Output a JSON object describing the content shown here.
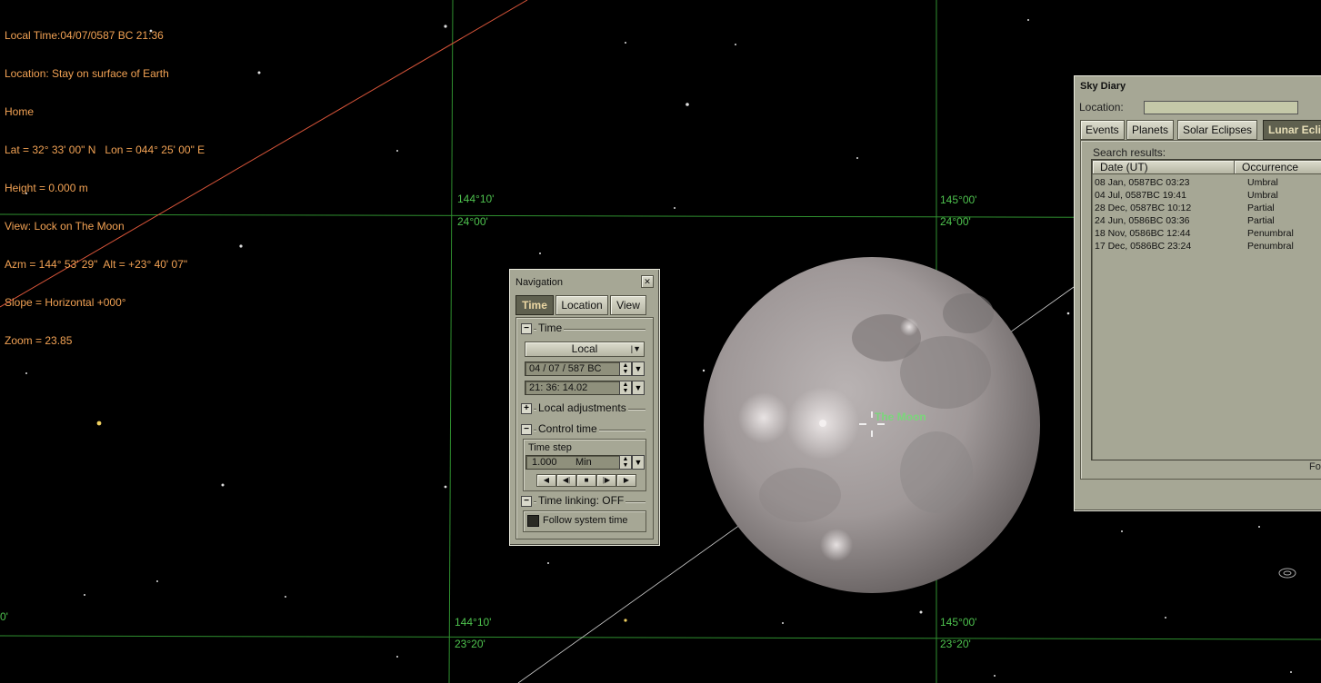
{
  "hud": {
    "lines": [
      "Local Time:04/07/0587 BC 21:36",
      "Location: Stay on surface of Earth",
      "Home",
      "Lat = 32° 33' 00\" N   Lon = 044° 25' 00\" E",
      "Height = 0.000 m",
      "View: Lock on The Moon",
      "Azm = 144° 53' 29\"  Alt = +23° 40' 07\"",
      "Slope = Horizontal +000°",
      "Zoom = 23.85"
    ]
  },
  "grid_labels": {
    "az_left_top": "144°10'",
    "alt_left_top": "24°00'",
    "az_right_top": "145°00'",
    "alt_right_top": "24°00'",
    "az_left_bottom": "144°10'",
    "alt_left_bottom": "23°20'",
    "az_right_bottom": "145°00'",
    "alt_right_bottom": "23°20'",
    "left_edge": "0'"
  },
  "moon": {
    "label": "The Moon"
  },
  "navigation": {
    "title": "Navigation",
    "close_glyph": "✕",
    "tabs": [
      "Time",
      "Location",
      "View"
    ],
    "active_tab": "Time",
    "time_section": "Time",
    "time_mode": "Local",
    "date_value": "04 / 07 /  587    BC",
    "time_value": "21:   36: 14.02",
    "local_adjustments": "Local adjustments",
    "control_time": "Control time",
    "time_step_label": "Time step",
    "time_step_value": "1.000",
    "time_step_unit": "Min",
    "time_linking": "Time linking: OFF",
    "follow_system_time": "Follow system time",
    "follow_system_time_checked": false
  },
  "sky_diary": {
    "title": "Sky Diary",
    "location_label": "Location:",
    "location_value": "",
    "tabs": [
      "Events",
      "Planets",
      "Solar Eclipses",
      "Lunar Eclipses"
    ],
    "active_tab": "Lunar Eclipses",
    "results_label": "Search results:",
    "columns": [
      "Date (UT)",
      "Occurrence"
    ],
    "rows": [
      [
        "08 Jan, 0587BC 03:23",
        "Umbral"
      ],
      [
        "04 Jul, 0587BC 19:41",
        "Umbral"
      ],
      [
        "28 Dec, 0587BC 10:12",
        "Partial"
      ],
      [
        "24 Jun, 0586BC 03:36",
        "Partial"
      ],
      [
        "18 Nov, 0586BC 12:44",
        "Penumbral"
      ],
      [
        "17 Dec, 0586BC 23:24",
        "Penumbral"
      ]
    ],
    "footer_button": "Fo"
  },
  "colors": {
    "hud_text": "#f2a254",
    "grid": "#2f8f2f",
    "grid_label": "#4ec24e",
    "horizon_line": "#d9553a",
    "window_face": "#a6a795"
  }
}
